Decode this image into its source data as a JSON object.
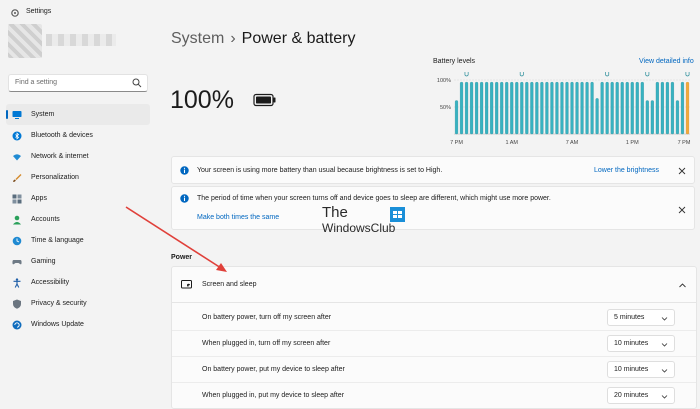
{
  "window": {
    "title": "Settings"
  },
  "search": {
    "placeholder": "Find a setting"
  },
  "sidebar": {
    "items": [
      {
        "label": "System",
        "icon": "monitor-icon",
        "active": true
      },
      {
        "label": "Bluetooth & devices",
        "icon": "bluetooth-icon"
      },
      {
        "label": "Network & internet",
        "icon": "wifi-icon"
      },
      {
        "label": "Personalization",
        "icon": "brush-icon"
      },
      {
        "label": "Apps",
        "icon": "apps-icon"
      },
      {
        "label": "Accounts",
        "icon": "person-icon"
      },
      {
        "label": "Time & language",
        "icon": "globe-clock-icon"
      },
      {
        "label": "Gaming",
        "icon": "gamepad-icon"
      },
      {
        "label": "Accessibility",
        "icon": "accessibility-icon"
      },
      {
        "label": "Privacy & security",
        "icon": "shield-icon"
      },
      {
        "label": "Windows Update",
        "icon": "update-icon"
      }
    ]
  },
  "header": {
    "parent": "System",
    "separator": "›",
    "title": "Power & battery"
  },
  "battery": {
    "percent": "100%"
  },
  "chart_data": {
    "type": "bar",
    "title": "Battery levels",
    "link": "View detailed info",
    "yticks": [
      "100%",
      "50%"
    ],
    "xticks": [
      "7 PM",
      "1 AM",
      "7 AM",
      "1 PM",
      "7 PM"
    ],
    "ylim": [
      0,
      100
    ],
    "values": [
      62,
      96,
      96,
      96,
      96,
      96,
      96,
      96,
      96,
      96,
      96,
      96,
      96,
      96,
      96,
      96,
      96,
      96,
      96,
      96,
      96,
      96,
      96,
      96,
      96,
      96,
      96,
      96,
      66,
      96,
      96,
      96,
      96,
      96,
      96,
      96,
      96,
      96,
      62,
      62,
      96,
      96,
      96,
      96,
      62,
      96,
      96
    ],
    "charging": [
      false,
      false,
      false,
      false,
      false,
      false,
      false,
      false,
      false,
      false,
      false,
      false,
      false,
      false,
      false,
      false,
      false,
      false,
      false,
      false,
      false,
      false,
      false,
      false,
      false,
      false,
      false,
      false,
      false,
      false,
      false,
      false,
      false,
      false,
      false,
      false,
      false,
      false,
      false,
      false,
      false,
      false,
      false,
      false,
      false,
      false,
      true
    ],
    "plug_markers_at": [
      2,
      13,
      30,
      38,
      46
    ],
    "colors": {
      "bar": "#38b2c1",
      "bar_edge": "#2d8f9b",
      "charging": "#f2a93b",
      "grid": "#d6d6d6"
    }
  },
  "banners": [
    {
      "text": "Your screen is using more battery than usual because brightness is set to High.",
      "link": "Lower the brightness"
    },
    {
      "text": "The period of time when your screen turns off and device goes to sleep are different, which might use more power.",
      "link": "Make both times the same"
    }
  ],
  "watermark": {
    "line1": "The",
    "line2": "WindowsClub"
  },
  "power": {
    "section_label": "Power",
    "group_title": "Screen and sleep",
    "rows": [
      {
        "label": "On battery power, turn off my screen after",
        "value": "5 minutes"
      },
      {
        "label": "When plugged in, turn off my screen after",
        "value": "10 minutes"
      },
      {
        "label": "On battery power, put my device to sleep after",
        "value": "10 minutes"
      },
      {
        "label": "When plugged in, put my device to sleep after",
        "value": "20 minutes"
      }
    ]
  },
  "colors": {
    "accent": "#0067c0",
    "arrow": "#e0403a"
  }
}
